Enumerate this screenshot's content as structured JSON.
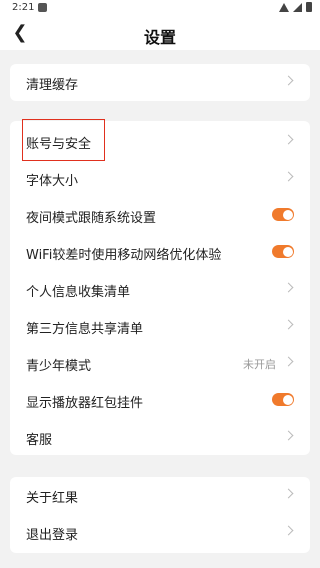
{
  "status_bar": {
    "time": "2:21"
  },
  "header": {
    "title": "设置",
    "back_icon": "back-arrow-icon"
  },
  "sections": [
    {
      "items": [
        {
          "label": "清理缓存",
          "type": "link"
        }
      ]
    },
    {
      "items": [
        {
          "label": "账号与安全",
          "type": "link",
          "highlighted": true
        },
        {
          "label": "字体大小",
          "type": "link"
        },
        {
          "label": "夜间模式跟随系统设置",
          "type": "toggle",
          "on": true
        },
        {
          "label": "WiFi较差时使用移动网络优化体验",
          "type": "toggle",
          "on": true
        },
        {
          "label": "个人信息收集清单",
          "type": "link"
        },
        {
          "label": "第三方信息共享清单",
          "type": "link"
        },
        {
          "label": "青少年模式",
          "type": "link",
          "status": "未开启"
        },
        {
          "label": "显示播放器红包挂件",
          "type": "toggle",
          "on": true
        },
        {
          "label": "客服",
          "type": "link"
        }
      ]
    },
    {
      "items": [
        {
          "label": "关于红果",
          "type": "link"
        },
        {
          "label": "退出登录",
          "type": "link"
        }
      ]
    }
  ],
  "colors": {
    "accent": "#f07a2c",
    "highlight_box": "#e0301e"
  }
}
